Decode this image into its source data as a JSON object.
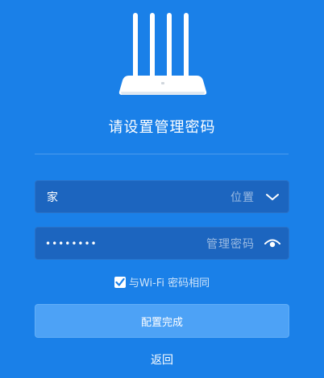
{
  "header": {
    "title": "请设置管理密码"
  },
  "location_field": {
    "value": "家",
    "hint": "位置",
    "icon": "chevron-down-icon"
  },
  "password_field": {
    "masked_value": "••••••••",
    "hint": "管理密码",
    "icon": "eye-icon"
  },
  "sync_option": {
    "checked": true,
    "label": "与Wi-Fi 密码相同"
  },
  "actions": {
    "confirm_label": "配置完成",
    "back_label": "返回"
  },
  "colors": {
    "background": "#1a80e8",
    "field_background": "#1c65bf",
    "button_background": "#4da2f6"
  }
}
